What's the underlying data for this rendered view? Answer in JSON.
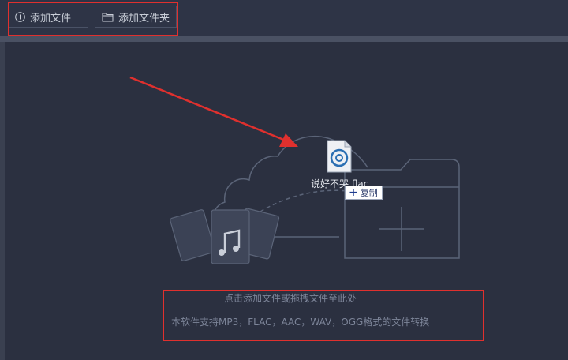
{
  "toolbar": {
    "add_file_label": "添加文件",
    "add_folder_label": "添加文件夹"
  },
  "drop_zone": {
    "drag_file_name": "说好不哭.flac",
    "copy_badge_label": "复制",
    "hint_primary": "点击添加文件或拖拽文件至此处",
    "hint_formats": "本软件支持MP3，FLAC，AAC，WAV，OGG格式的文件转换"
  },
  "colors": {
    "background": "#2c3143",
    "annotation_red": "#e0302e",
    "illustration_stroke": "#5b6478"
  },
  "icons": {
    "add_file": "plus-circle-icon",
    "add_folder": "folder-icon",
    "file_type": "audio-disc-icon"
  }
}
